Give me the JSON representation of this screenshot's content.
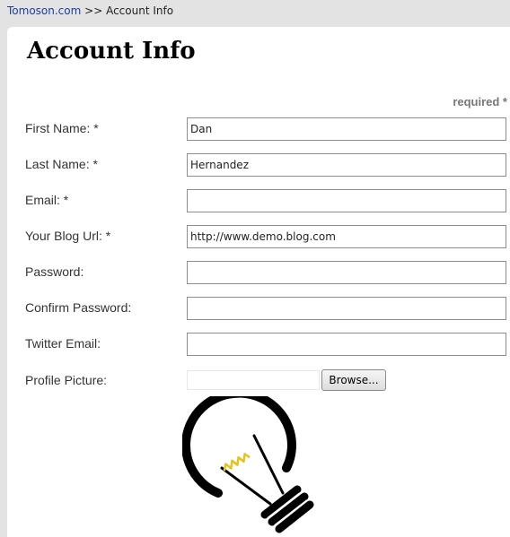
{
  "breadcrumb": {
    "home": "Tomoson.com",
    "separator": ">>",
    "current": "Account Info"
  },
  "page_title": "Account Info",
  "required_note": "required *",
  "fields": {
    "first_name": {
      "label": "First Name: *",
      "value": "Dan"
    },
    "last_name": {
      "label": "Last Name: *",
      "value": "Hernandez"
    },
    "email": {
      "label": "Email: *",
      "value": ""
    },
    "blog_url": {
      "label": "Your Blog Url: *",
      "value": "http://www.demo.blog.com"
    },
    "password": {
      "label": "Password:",
      "value": ""
    },
    "confirm_password": {
      "label": "Confirm Password:",
      "value": ""
    },
    "twitter_email": {
      "label": "Twitter Email:",
      "value": ""
    },
    "profile_picture": {
      "label": "Profile Picture:",
      "browse_label": "Browse..."
    }
  },
  "image": {
    "icon": "lightbulb-icon"
  }
}
